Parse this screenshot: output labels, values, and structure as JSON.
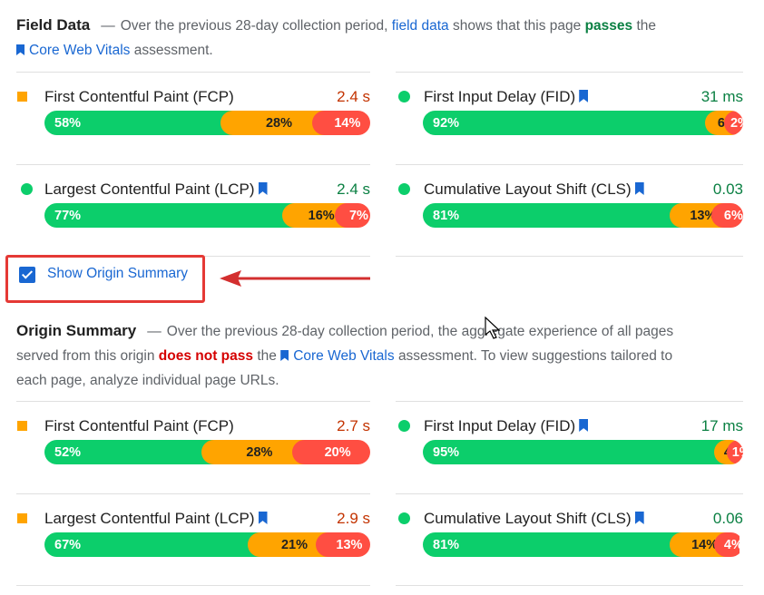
{
  "field": {
    "title": "Field Data",
    "desc_pre": "Over the previous 28-day collection period,",
    "desc_link": "field data",
    "desc_mid": "shows that this page",
    "status": "passes",
    "desc_the": "the",
    "cwv_link": "Core Web Vitals",
    "desc_post": "assessment."
  },
  "field_metrics": [
    {
      "name": "First Contentful Paint (FCP)",
      "value": "2.4 s",
      "good": "58%",
      "avg": "28%",
      "poor": "14%",
      "good_pct": 58,
      "avg_pct": 28,
      "poor_pct": 14,
      "indicator": "orange-square"
    },
    {
      "name": "First Input Delay (FID)",
      "value": "31 ms",
      "good": "92%",
      "avg": "6%",
      "poor": "2%",
      "good_pct": 92,
      "avg_pct": 6,
      "poor_pct": 2,
      "indicator": "green-circle"
    },
    {
      "name": "Largest Contentful Paint (LCP)",
      "value": "2.4 s",
      "good": "77%",
      "avg": "16%",
      "poor": "7%",
      "good_pct": 77,
      "avg_pct": 16,
      "poor_pct": 7,
      "indicator": "green-circle"
    },
    {
      "name": "Cumulative Layout Shift (CLS)",
      "value": "0.03",
      "good": "81%",
      "avg": "13%",
      "poor": "6%",
      "good_pct": 81,
      "avg_pct": 13,
      "poor_pct": 6,
      "indicator": "green-circle"
    }
  ],
  "checkbox": {
    "label": "Show Origin Summary",
    "checked": true
  },
  "origin": {
    "title": "Origin Summary",
    "desc_pre": "Over the previous 28-day collection period, the aggregate experience of all pages",
    "desc_line2_pre": "served from this origin",
    "status": "does not pass",
    "desc_the": "the",
    "cwv_link": "Core Web Vitals",
    "desc_post": "assessment. To view suggestions tailored to",
    "desc_line3": "each page, analyze individual page URLs."
  },
  "origin_metrics": [
    {
      "name": "First Contentful Paint (FCP)",
      "value": "2.7 s",
      "good": "52%",
      "avg": "28%",
      "poor": "20%",
      "good_pct": 52,
      "avg_pct": 28,
      "poor_pct": 20,
      "indicator": "orange-square"
    },
    {
      "name": "First Input Delay (FID)",
      "value": "17 ms",
      "good": "95%",
      "avg": "4%",
      "poor": "1%",
      "good_pct": 95,
      "avg_pct": 4,
      "poor_pct": 1,
      "indicator": "green-circle"
    },
    {
      "name": "Largest Contentful Paint (LCP)",
      "value": "2.9 s",
      "good": "67%",
      "avg": "21%",
      "poor": "13%",
      "good_pct": 67,
      "avg_pct": 21,
      "poor_pct": 13,
      "indicator": "orange-square"
    },
    {
      "name": "Cumulative Layout Shift (CLS)",
      "value": "0.06",
      "good": "81%",
      "avg": "14%",
      "poor": "4%",
      "good_pct": 81,
      "avg_pct": 14,
      "poor_pct": 4,
      "indicator": "green-circle"
    }
  ],
  "colors": {
    "good": "#0cce6b",
    "average": "#ffa400",
    "poor": "#ff4e42",
    "link": "#1967d2",
    "highlight_box": "#e53935"
  }
}
